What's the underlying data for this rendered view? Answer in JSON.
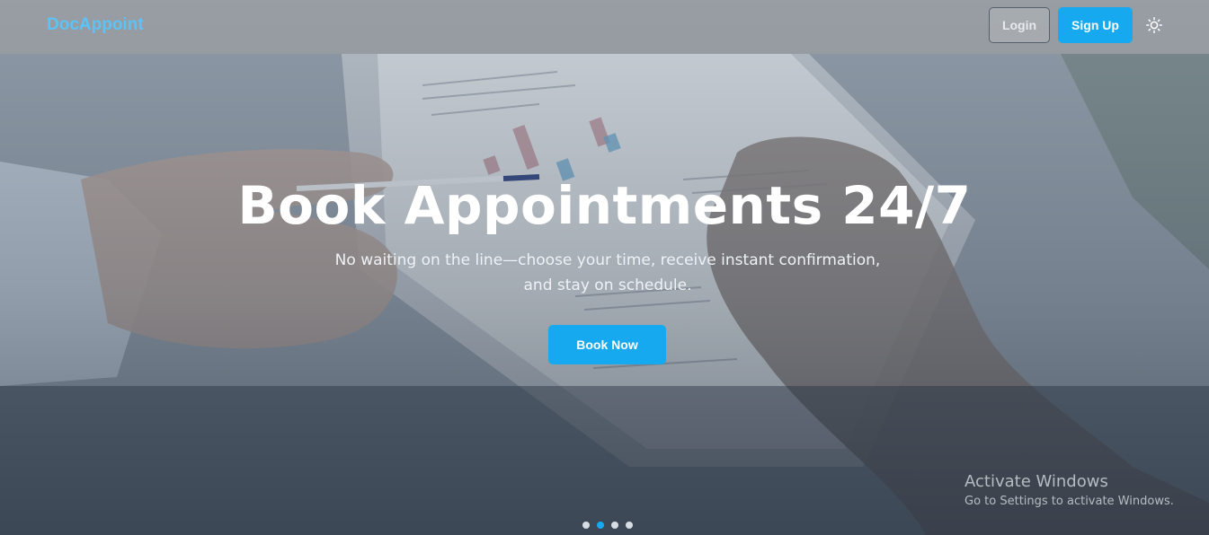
{
  "navbar": {
    "brand": "DocAppoint",
    "login_label": "Login",
    "signup_label": "Sign Up",
    "theme_icon": "sun-icon"
  },
  "hero": {
    "headline": "Book Appointments 24/7",
    "subtext": "No waiting on the line—choose your time, receive instant confirmation, and stay on schedule.",
    "cta_label": "Book Now"
  },
  "carousel": {
    "slide_count": 4,
    "active_index": 1
  },
  "watermark": {
    "title": "Activate Windows",
    "subtitle": "Go to Settings to activate Windows."
  },
  "colors": {
    "accent": "#17a9ef",
    "brand": "#5cc3f7",
    "headline": "#ffffff"
  }
}
